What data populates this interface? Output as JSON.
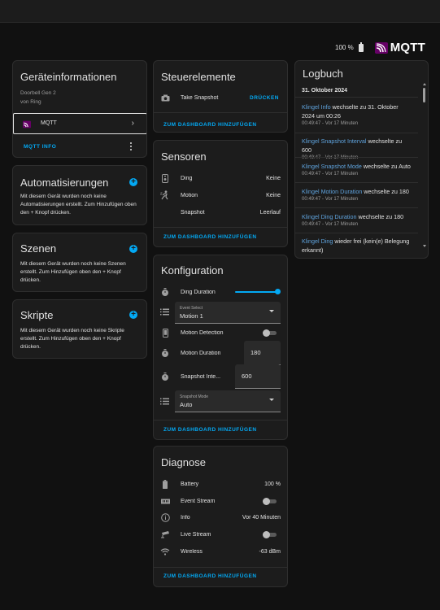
{
  "header": {
    "battery_pct": "100 %",
    "logo_text": "MQTT"
  },
  "device_info": {
    "title": "Geräteinformationen",
    "model": "Doorbell Gen 2",
    "by": "von Ring",
    "integration_label": "MQTT",
    "mqtt_info": "MQTT INFO"
  },
  "automations": {
    "title": "Automatisierungen",
    "text": "Mit diesem Gerät wurden noch keine Automatisierungen erstellt. Zum Hinzufügen oben den + Knopf drücken."
  },
  "scenes": {
    "title": "Szenen",
    "text": "Mit diesem Gerät wurden noch keine Szenen erstellt. Zum Hinzufügen oben den + Knopf drücken."
  },
  "scripts": {
    "title": "Skripte",
    "text": "Mit diesem Gerät wurden noch keine Skripte erstellt. Zum Hinzufügen oben den + Knopf drücken."
  },
  "controls": {
    "title": "Steuerelemente",
    "snapshot_label": "Take Snapshot",
    "press_label": "DRÜCKEN",
    "add_dashboard": "ZUM DASHBOARD HINZUFÜGEN"
  },
  "sensors": {
    "title": "Sensoren",
    "rows": [
      {
        "label": "Ding",
        "value": "Keine"
      },
      {
        "label": "Motion",
        "value": "Keine"
      },
      {
        "label": "Snapshot",
        "value": "Leerlauf"
      }
    ],
    "add_dashboard": "ZUM DASHBOARD HINZUFÜGEN"
  },
  "config": {
    "title": "Konfiguration",
    "ding_duration_label": "Ding Duration",
    "ding_duration_fraction": 1.0,
    "event_select_label": "Event Select",
    "event_select_value": "Motion 1",
    "motion_detection_label": "Motion Detection",
    "motion_duration_label": "Motion Duration",
    "motion_duration_value": "180",
    "snapshot_interval_label": "Snapshot Inte...",
    "snapshot_interval_value": "600",
    "snapshot_mode_label": "Snapshot Mode",
    "snapshot_mode_value": "Auto",
    "add_dashboard": "ZUM DASHBOARD HINZUFÜGEN"
  },
  "diagnostics": {
    "title": "Diagnose",
    "rows": [
      {
        "label": "Battery",
        "value": "100 %"
      },
      {
        "label": "Event Stream",
        "value": ""
      },
      {
        "label": "Info",
        "value": "Vor 40 Minuten"
      },
      {
        "label": "Live Stream",
        "value": ""
      },
      {
        "label": "Wireless",
        "value": "-63 dBm"
      }
    ],
    "add_dashboard": "ZUM DASHBOARD HINZUFÜGEN"
  },
  "logbook": {
    "title": "Logbuch",
    "date": "31. Oktober 2024",
    "entries": [
      {
        "entity": "Klingel Info",
        "text": " wechselte zu 31. Oktober 2024 um 00:26",
        "time": "00:49:47 - Vor 17 Minuten"
      },
      {
        "entity": "Klingel Snapshot Interval",
        "text": " wechselte zu 600",
        "time": "00:49:47 - Vor 17 Minuten"
      },
      {
        "entity": "Klingel Snapshot Mode",
        "text": " wechselte zu Auto",
        "time": "00:49:47 - Vor 17 Minuten"
      },
      {
        "entity": "Klingel Motion Duration",
        "text": " wechselte zu 180",
        "time": "00:49:47 - Vor 17 Minuten"
      },
      {
        "entity": "Klingel Ding Duration",
        "text": " wechselte zu 180",
        "time": "00:49:47 - Vor 17 Minuten"
      },
      {
        "entity": "Klingel Ding",
        "text": " wieder frei (kein(e) Belegung erkannt)",
        "time": ""
      }
    ]
  }
}
